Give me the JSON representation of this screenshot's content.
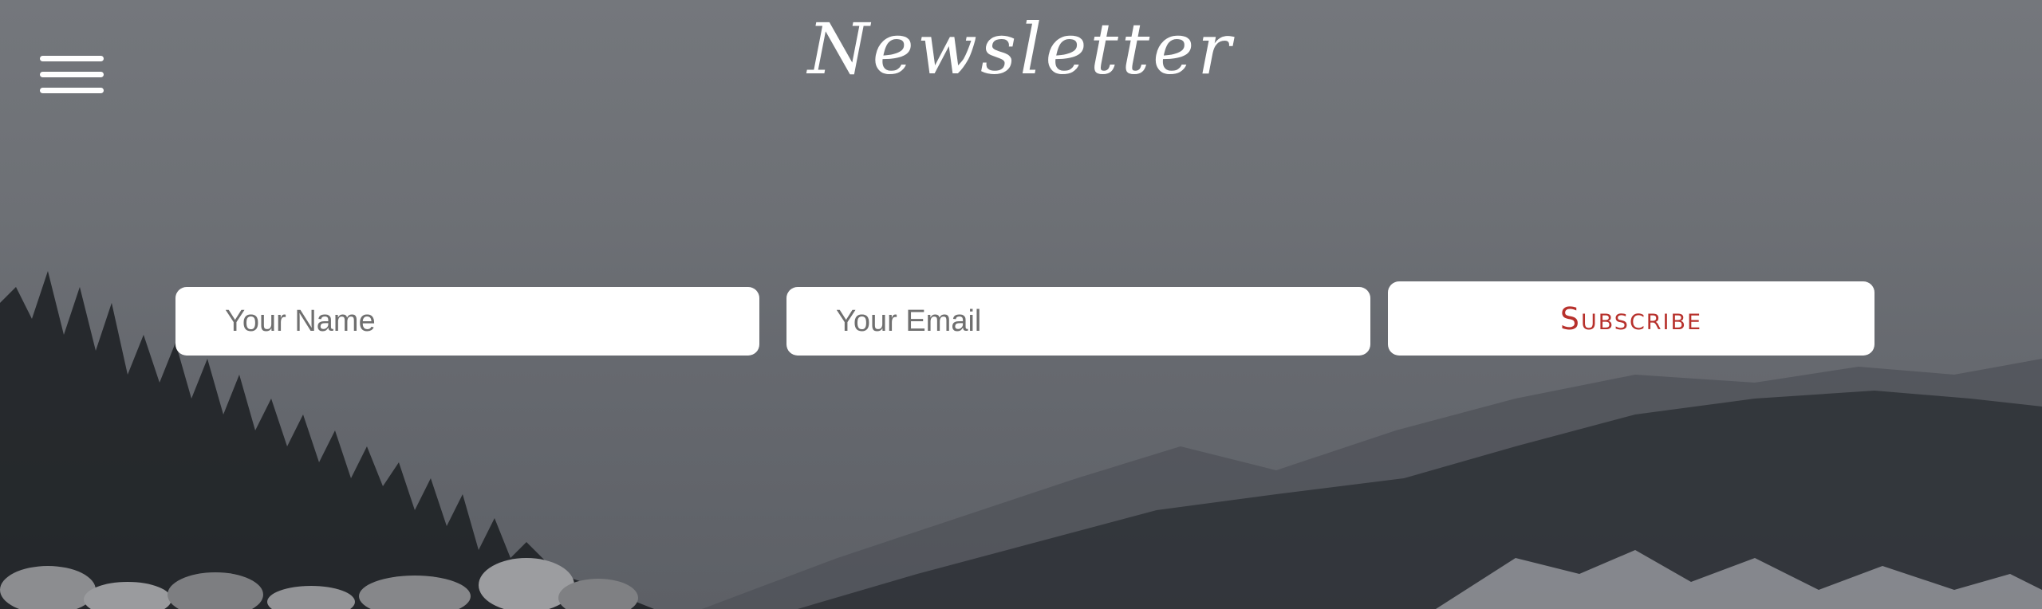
{
  "header": {
    "title": "Newsletter",
    "menu_icon": "hamburger-menu-icon"
  },
  "form": {
    "name_placeholder": "Your Name",
    "email_placeholder": "Your Email",
    "subscribe_label": "Subscribe"
  },
  "colors": {
    "accent": "#b7312c",
    "text_on_background": "#ffffff",
    "field_background": "#ffffff"
  }
}
